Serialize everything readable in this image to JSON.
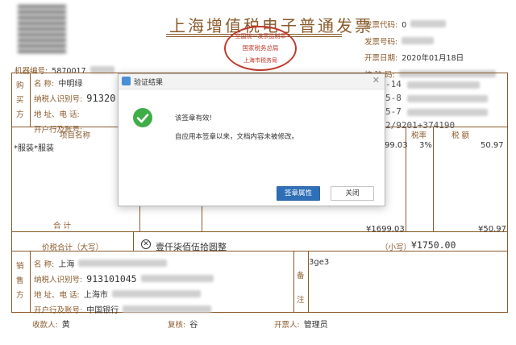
{
  "invoice": {
    "title": "上海增值税电子普通发票",
    "seal_lines": [
      "国家税务总局",
      "全国统一发票监制章",
      "上海市税务局"
    ],
    "machine_label": "机器编号:",
    "machine_value": "5870017",
    "header_fields": [
      {
        "label": "发票代码:",
        "value": "0"
      },
      {
        "label": "发票号码:",
        "value": ""
      },
      {
        "label": "开票日期:",
        "value": "2020年01月18日"
      },
      {
        "label": "校 验 码:",
        "value": ""
      }
    ],
    "buyer": {
      "side_label": [
        "购",
        "买",
        "方"
      ],
      "name_label": "名          称:",
      "name_value": "中明绿",
      "tax_label": "纳税人识别号:",
      "tax_value": "91320",
      "addr_label": "地 址、电 话:",
      "bank_label": "开户行及账号:"
    },
    "cipher_lines": [
      "-14",
      "5-8",
      "5-7",
      "2/9201+374190"
    ],
    "columns": {
      "item": "项目名称",
      "tax_rate": "税率",
      "tax": "税    额"
    },
    "row": {
      "item": "*服装*服装",
      "amount_partial": "99.03",
      "rate": "3%",
      "tax": "50.97"
    },
    "subtotal": {
      "label": "合        计",
      "amount": "¥1699.03",
      "tax": "¥50.97"
    },
    "total": {
      "label": "价税合计（大写）",
      "words": "壹仟柒佰伍拾圆整",
      "small_label": "（小写）",
      "small_value": "¥1750.00"
    },
    "seller": {
      "side_label": [
        "销",
        "售",
        "方"
      ],
      "name_label": "名          称:",
      "name_value": "上海",
      "tax_label": "纳税人识别号:",
      "tax_value": "913101045",
      "addr_label": "地 址、电 话:",
      "addr_value": "上海市",
      "bank_label": "开户行及账号:",
      "bank_value": "中国银行"
    },
    "remark": {
      "side_label": [
        "备",
        "注"
      ],
      "value": "3ge3"
    },
    "footer": {
      "payee_label": "收款人:",
      "payee_value": "黄",
      "reviewer_label": "复核:",
      "reviewer_value": "谷",
      "issuer_label": "开票人:",
      "issuer_value": "管理员"
    }
  },
  "dialog": {
    "title": "验证结果",
    "message": "该签章有效!",
    "detail": "自应用本签章以来，文档内容未被修改。",
    "props_button": "签章属性",
    "close_button": "关闭",
    "accent": "#2f6fb7",
    "success_color": "#3fae49"
  }
}
